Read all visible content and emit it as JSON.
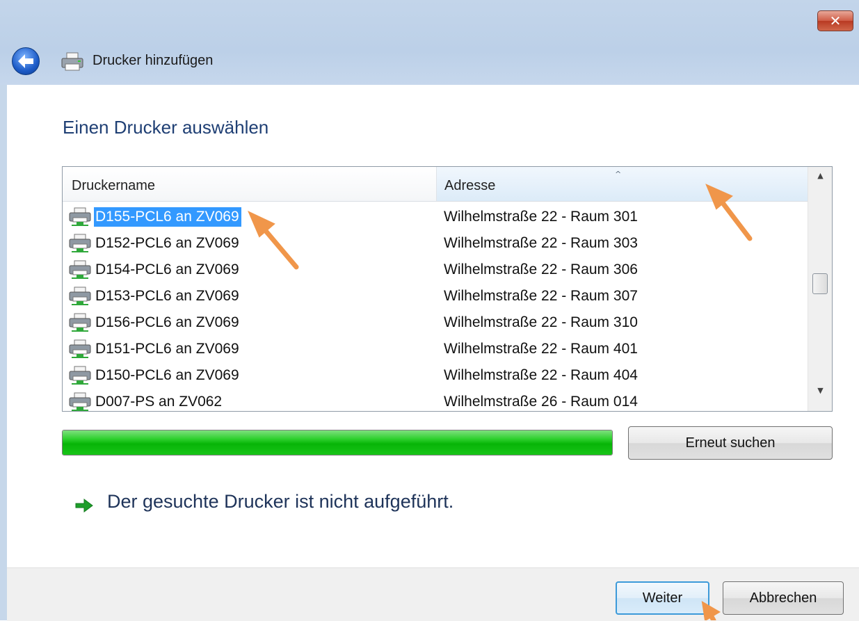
{
  "window": {
    "title": "Drucker hinzufügen",
    "close_label": "✕"
  },
  "page": {
    "heading": "Einen Drucker auswählen"
  },
  "list": {
    "columns": {
      "name": "Druckername",
      "address": "Adresse"
    },
    "sort_indicator": "^",
    "rows": [
      {
        "name": "D155-PCL6 an ZV069",
        "address": "Wilhelmstraße 22 - Raum 301",
        "selected": true
      },
      {
        "name": "D152-PCL6 an ZV069",
        "address": "Wilhelmstraße 22 - Raum 303"
      },
      {
        "name": "D154-PCL6 an ZV069",
        "address": "Wilhelmstraße 22 - Raum 306"
      },
      {
        "name": "D153-PCL6 an ZV069",
        "address": "Wilhelmstraße 22 - Raum 307"
      },
      {
        "name": "D156-PCL6 an ZV069",
        "address": "Wilhelmstraße 22 - Raum 310"
      },
      {
        "name": "D151-PCL6 an ZV069",
        "address": "Wilhelmstraße 22 - Raum 401"
      },
      {
        "name": "D150-PCL6 an ZV069",
        "address": "Wilhelmstraße 22 - Raum 404"
      },
      {
        "name": "D007-PS an ZV062",
        "address": "Wilhelmstraße 26 - Raum 014"
      }
    ]
  },
  "search": {
    "progress_fraction": 1.0,
    "retry_label": "Erneut suchen"
  },
  "link": {
    "text": "Der gesuchte Drucker ist nicht aufgeführt."
  },
  "footer": {
    "next_label": "Weiter",
    "cancel_label": "Abbrechen"
  },
  "colors": {
    "selection": "#3399ff",
    "heading": "#1f3f74",
    "progress_green": "#07b507",
    "annotation_arrow": "#f0964a"
  },
  "icons": {
    "back": "back-arrow-icon",
    "title": "printer-icon",
    "row": "network-printer-icon",
    "link": "green-arrow-icon"
  }
}
